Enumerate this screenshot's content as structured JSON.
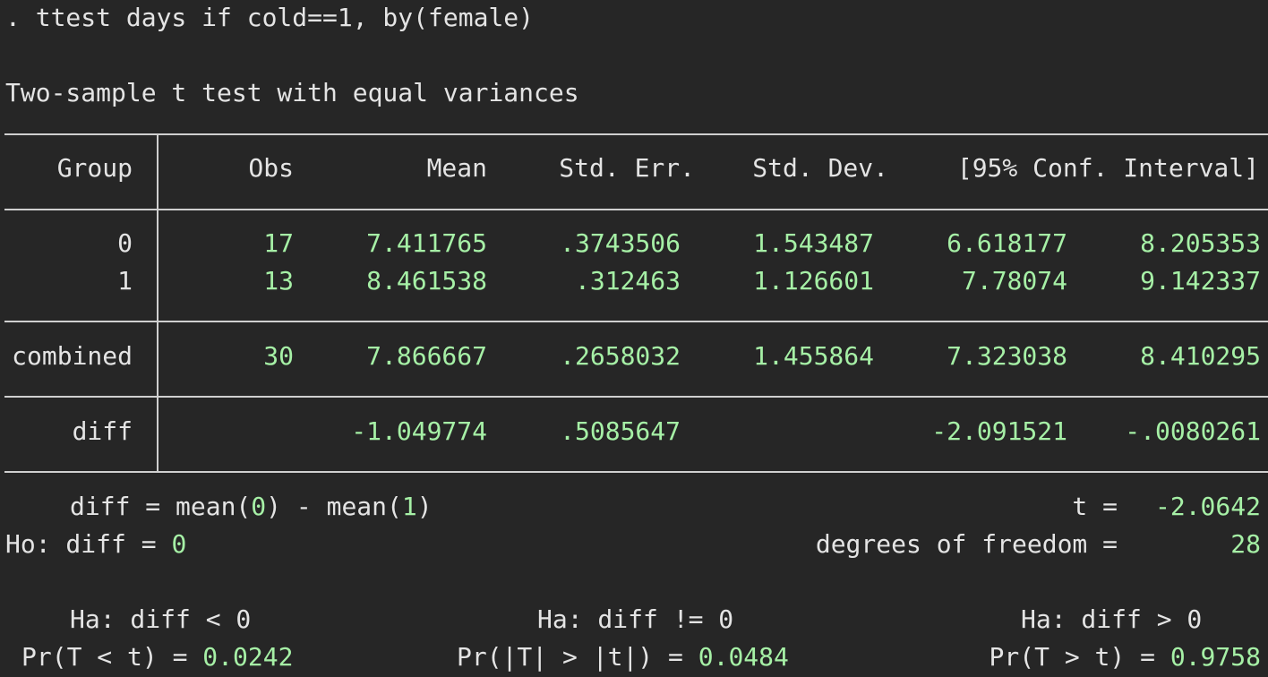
{
  "command": ". ttest days if cold==1, by(female)",
  "title": "Two-sample t test with equal variances",
  "headers": {
    "group": "Group",
    "obs": "Obs",
    "mean": "Mean",
    "std_err": "Std. Err.",
    "std_dev": "Std. Dev.",
    "conf_interval": "[95% Conf. Interval]"
  },
  "rows": [
    {
      "group": "0",
      "obs": "17",
      "mean": "7.411765",
      "std_err": ".3743506",
      "std_dev": "1.543487",
      "ci_low": "6.618177",
      "ci_high": "8.205353"
    },
    {
      "group": "1",
      "obs": "13",
      "mean": "8.461538",
      "std_err": ".312463",
      "std_dev": "1.126601",
      "ci_low": "7.78074",
      "ci_high": "9.142337"
    }
  ],
  "combined": {
    "group": "combined",
    "obs": "30",
    "mean": "7.866667",
    "std_err": ".2658032",
    "std_dev": "1.455864",
    "ci_low": "7.323038",
    "ci_high": "8.410295"
  },
  "diff": {
    "group": "diff",
    "mean": "-1.049774",
    "std_err": ".5085647",
    "ci_low": "-2.091521",
    "ci_high": "-.0080261"
  },
  "hypothesis": {
    "diff_def_prefix": "diff = mean(",
    "diff_def_a": "0",
    "diff_def_mid": ") - mean(",
    "diff_def_b": "1",
    "diff_def_suffix": ")",
    "t_label": "t =",
    "t_value": "-2.0642",
    "ho_prefix": "Ho: diff = ",
    "ho_value": "0",
    "dof_label": "degrees of freedom =",
    "dof_value": "28"
  },
  "alternatives": [
    {
      "ha": "Ha: diff < 0",
      "pr_label": "Pr(T < t) =",
      "pr_value": "0.0242"
    },
    {
      "ha": "Ha: diff != 0",
      "pr_label": "Pr(|T| > |t|) =",
      "pr_value": "0.0484"
    },
    {
      "ha": "Ha: diff > 0",
      "pr_label": "Pr(T > t) =",
      "pr_value": "0.9758"
    }
  ],
  "colors": {
    "background": "#262626",
    "text": "#e4e4e4",
    "result_value": "#a6f0a6",
    "rule": "#cfcfcf"
  }
}
